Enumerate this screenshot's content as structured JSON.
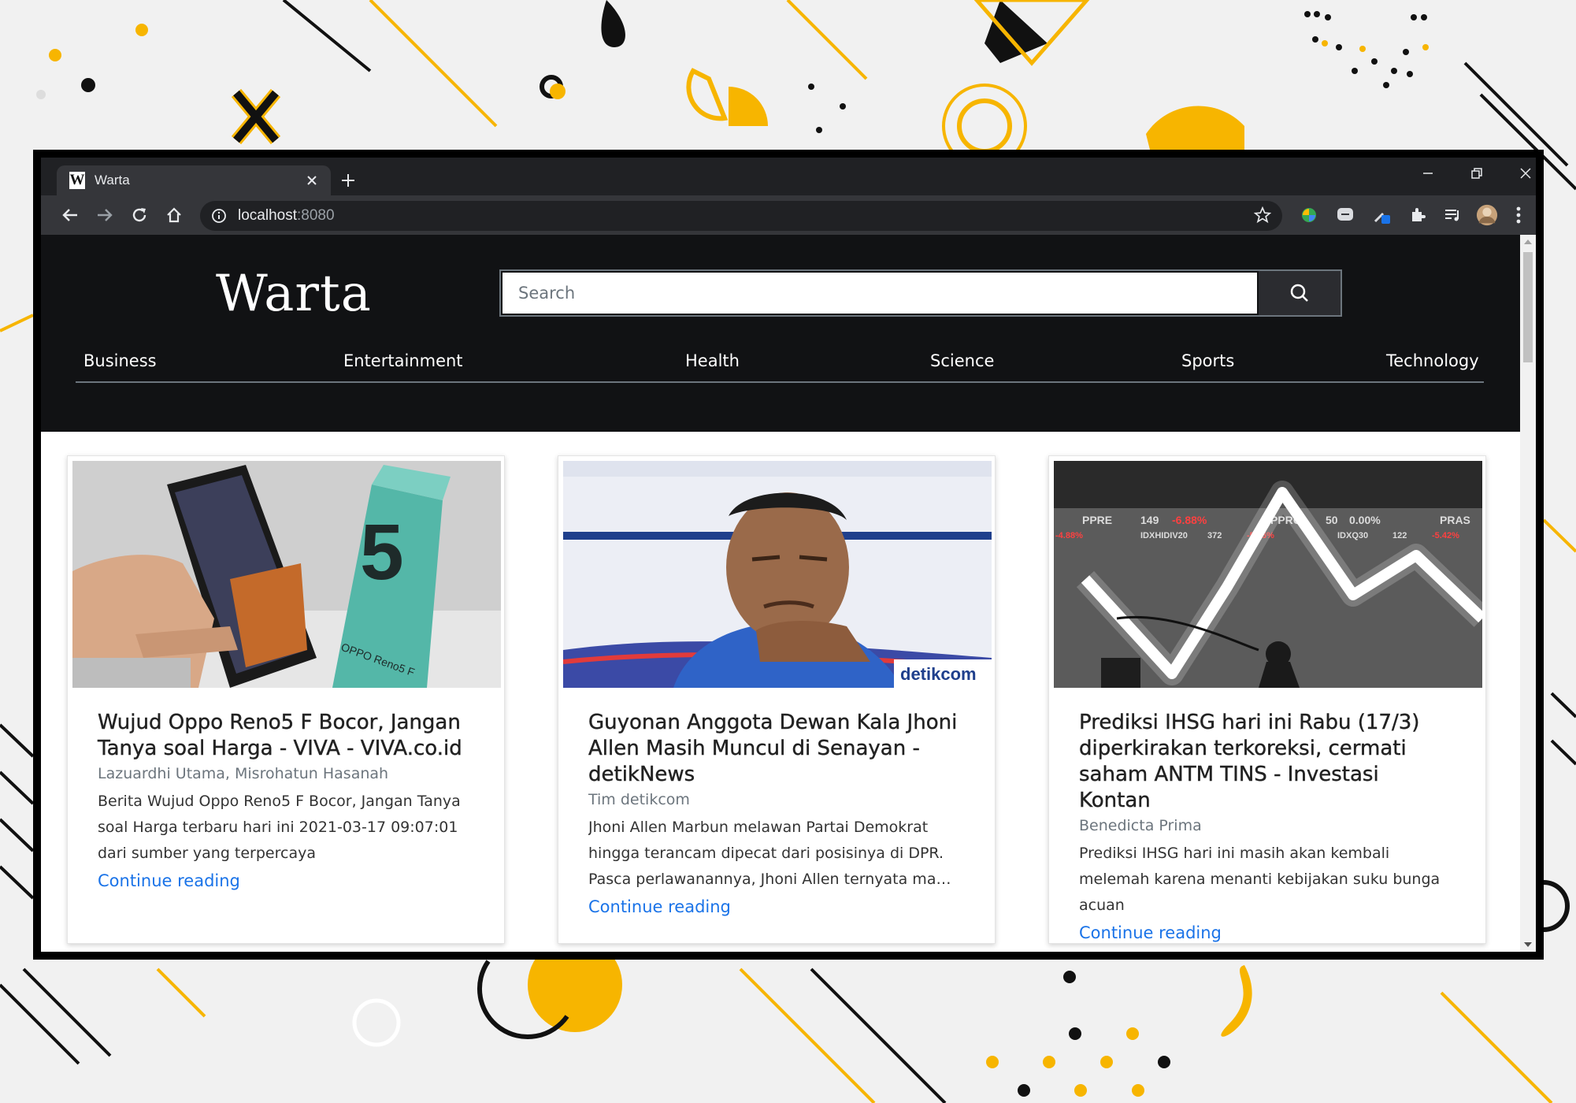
{
  "browser": {
    "tab_title": "Warta",
    "tab_favicon_letter": "W",
    "url_host": "localhost",
    "url_port": ":8080",
    "controls": [
      "back-icon",
      "forward-icon",
      "reload-icon",
      "home-icon",
      "info-icon",
      "star-icon",
      "puzzle-icon",
      "menu-dots-icon"
    ]
  },
  "site": {
    "logo": "Warta",
    "search_placeholder": "Search",
    "nav": [
      "Business",
      "Entertainment",
      "Health",
      "Science",
      "Sports",
      "Technology"
    ]
  },
  "articles": [
    {
      "title": "Wujud Oppo Reno5 F Bocor, Jangan Tanya soal Harga - VIVA - VIVA.co.id",
      "author": "Lazuardhi Utama, Misrohatun Hasanah",
      "description": "Berita Wujud Oppo Reno5 F Bocor, Jangan Tanya soal Harga terbaru hari ini 2021-03-17 09:07:01 dari sumber yang terpercaya",
      "link": "Continue reading",
      "image_text": [
        "5",
        "OPPO Reno5 F"
      ]
    },
    {
      "title": "Guyonan Anggota Dewan Kala Jhoni Allen Masih Muncul di Senayan - detikNews",
      "author": "Tim detikcom",
      "description": "Jhoni Allen Marbun melawan Partai Demokrat hingga terancam dipecat dari posisinya di DPR. Pasca perlawanannya, Jhoni Allen ternyata masih muncul di Senayan.",
      "link": "Continue reading",
      "image_text": [
        "detikcom"
      ]
    },
    {
      "title": "Prediksi IHSG hari ini Rabu (17/3) diperkirakan terkoreksi, cermati saham ANTM TINS - Investasi Kontan",
      "author": "Benedicta Prima",
      "description": "Prediksi IHSG hari ini masih akan kembali melemah karena menanti kebijakan suku bunga acuan",
      "link": "Continue reading",
      "image_text": [
        "PPRE",
        "149",
        "-6.88%",
        "PPRO",
        "50",
        "0.00%",
        "PRAS",
        "IDXHIDIV20",
        "372",
        "-5.46%",
        "IDXQ30",
        "122",
        "-5.42%",
        "-4.88%"
      ]
    }
  ],
  "colors": {
    "accent": "#ffb000",
    "header_bg": "#111214",
    "link": "#1a73e8"
  }
}
